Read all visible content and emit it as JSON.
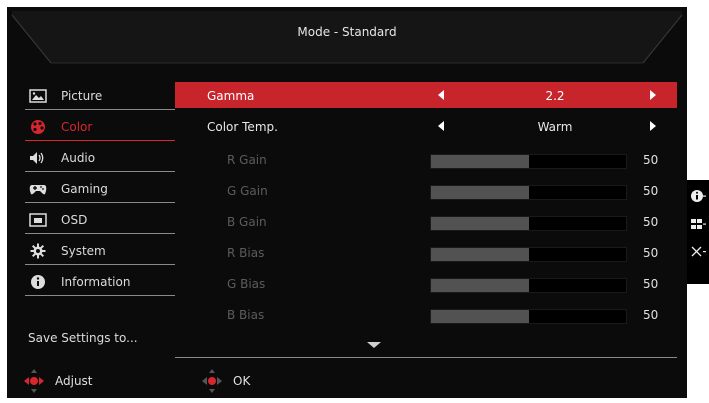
{
  "header": {
    "mode_title": "Mode - Standard"
  },
  "sidebar": {
    "items": [
      {
        "label": "Picture",
        "icon": "picture-icon",
        "active": false
      },
      {
        "label": "Color",
        "icon": "color-palette-icon",
        "active": true
      },
      {
        "label": "Audio",
        "icon": "speaker-icon",
        "active": false
      },
      {
        "label": "Gaming",
        "icon": "gamepad-icon",
        "active": false
      },
      {
        "label": "OSD",
        "icon": "osd-window-icon",
        "active": false
      },
      {
        "label": "System",
        "icon": "gear-icon",
        "active": false
      },
      {
        "label": "Information",
        "icon": "info-icon",
        "active": false
      }
    ],
    "save_settings": "Save Settings to..."
  },
  "main": {
    "gamma": {
      "label": "Gamma",
      "value": "2.2"
    },
    "color_temp": {
      "label": "Color Temp.",
      "value": "Warm"
    },
    "sliders": [
      {
        "label": "R Gain",
        "value": "50",
        "level": 0.5
      },
      {
        "label": "G Gain",
        "value": "50",
        "level": 0.5
      },
      {
        "label": "B Gain",
        "value": "50",
        "level": 0.5
      },
      {
        "label": "R Bias",
        "value": "50",
        "level": 0.5
      },
      {
        "label": "G Bias",
        "value": "50",
        "level": 0.5
      },
      {
        "label": "B Bias",
        "value": "50",
        "level": 0.5
      }
    ]
  },
  "footer": {
    "adjust": "Adjust",
    "ok": "OK"
  },
  "side_panel": {
    "icons": [
      "info-icon",
      "grid-icon",
      "close-icon"
    ]
  },
  "colors": {
    "accent": "#c8242c",
    "background": "#0b0b0b"
  }
}
